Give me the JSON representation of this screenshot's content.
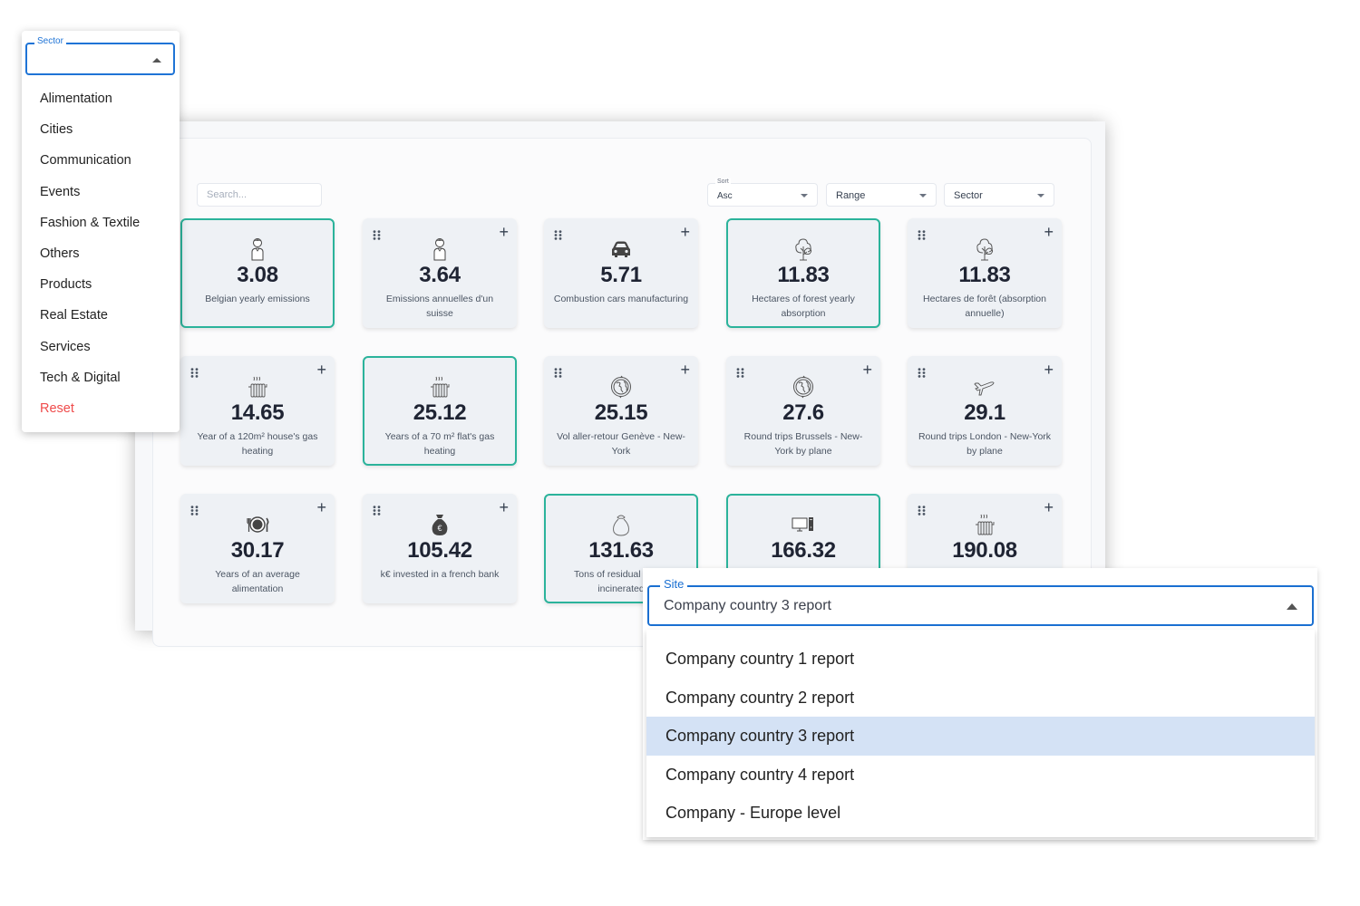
{
  "toolbar": {
    "search_placeholder": "Search...",
    "sort": {
      "label": "Sort",
      "value": "Asc"
    },
    "range": {
      "value": "Range"
    },
    "sector": {
      "value": "Sector"
    }
  },
  "cards": [
    {
      "value": "3.08",
      "label": "Belgian yearly emissions",
      "icon": "person-icon",
      "selected": true
    },
    {
      "value": "3.64",
      "label": "Emissions annuelles d'un suisse",
      "icon": "person-icon",
      "selected": false
    },
    {
      "value": "5.71",
      "label": "Combustion cars manufacturing",
      "icon": "car-icon",
      "selected": false
    },
    {
      "value": "11.83",
      "label": "Hectares of forest yearly absorption",
      "icon": "tree-icon",
      "selected": true
    },
    {
      "value": "11.83",
      "label": "Hectares de forêt (absorption annuelle)",
      "icon": "tree-icon",
      "selected": false
    },
    {
      "value": "14.65",
      "label": "Year of a 120m² house's gas heating",
      "icon": "radiator-icon",
      "selected": false
    },
    {
      "value": "25.12",
      "label": "Years of a 70 m² flat's gas heating",
      "icon": "radiator-icon",
      "selected": true
    },
    {
      "value": "25.15",
      "label": "Vol aller-retour Genève - New-York",
      "icon": "globe-icon",
      "selected": false
    },
    {
      "value": "27.6",
      "label": "Round trips Brussels - New-York by plane",
      "icon": "globe-icon",
      "selected": false
    },
    {
      "value": "29.1",
      "label": "Round trips London - New-York by plane",
      "icon": "plane-icon",
      "selected": false
    },
    {
      "value": "30.17",
      "label": "Years of an average alimentation",
      "icon": "plate-icon",
      "selected": false
    },
    {
      "value": "105.42",
      "label": "k€ invested in a french bank",
      "icon": "money-bag-icon",
      "selected": false
    },
    {
      "value": "131.63",
      "label": "Tons of residual waste incinerated",
      "icon": "trash-bag-icon",
      "selected": true
    },
    {
      "value": "166.32",
      "label": "",
      "icon": "computer-icon",
      "selected": true
    },
    {
      "value": "190.08",
      "label": "",
      "icon": "radiator-icon",
      "selected": false
    }
  ],
  "sector_dropdown": {
    "label": "Sector",
    "value": "",
    "options": [
      "Alimentation",
      "Cities",
      "Communication",
      "Events",
      "Fashion & Textile",
      "Others",
      "Products",
      "Real Estate",
      "Services",
      "Tech & Digital"
    ],
    "reset_label": "Reset",
    "reset_color": "#ef4b4b"
  },
  "site_dropdown": {
    "label": "Site",
    "value": "Company country 3 report",
    "options": [
      "Company country 1 report",
      "Company country 2 report",
      "Company country 3 report",
      "Company country 4 report",
      "Company - Europe level"
    ],
    "highlighted_index": 2
  },
  "colors": {
    "selected_border": "#2bb39b",
    "focus_blue": "#1a6fd1",
    "highlight": "#d4e2f5",
    "card_bg": "#eef1f5"
  }
}
